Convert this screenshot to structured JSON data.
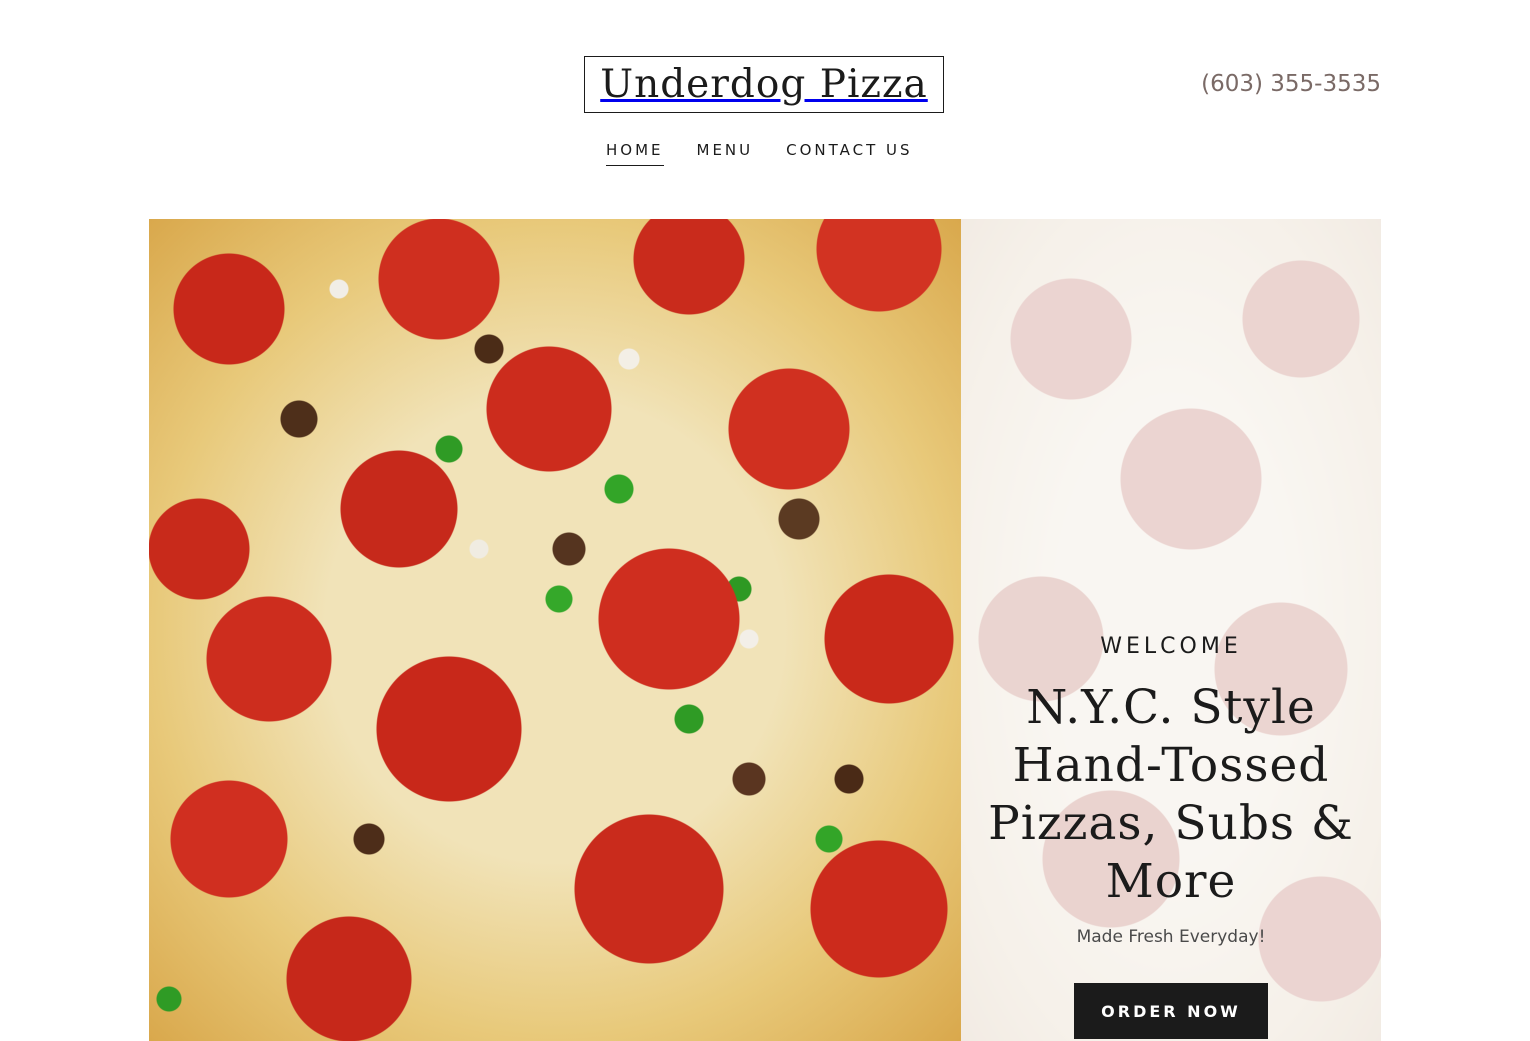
{
  "header": {
    "logo": "Underdog Pizza",
    "phone": "(603) 355-3535",
    "nav": [
      {
        "label": "HOME",
        "active": true
      },
      {
        "label": "MENU",
        "active": false
      },
      {
        "label": "CONTACT US",
        "active": false
      }
    ]
  },
  "hero": {
    "image": "pizza-photo",
    "eyebrow": "WELCOME",
    "headline": "N.Y.C. Style Hand-Tossed Pizzas, Subs & More",
    "tagline": "Made Fresh Everyday!",
    "cta_label": "ORDER NOW"
  },
  "colors": {
    "text": "#1b1b1b",
    "phone": "#7a6a66",
    "button_bg": "#1b1b1b",
    "button_text": "#ffffff"
  }
}
